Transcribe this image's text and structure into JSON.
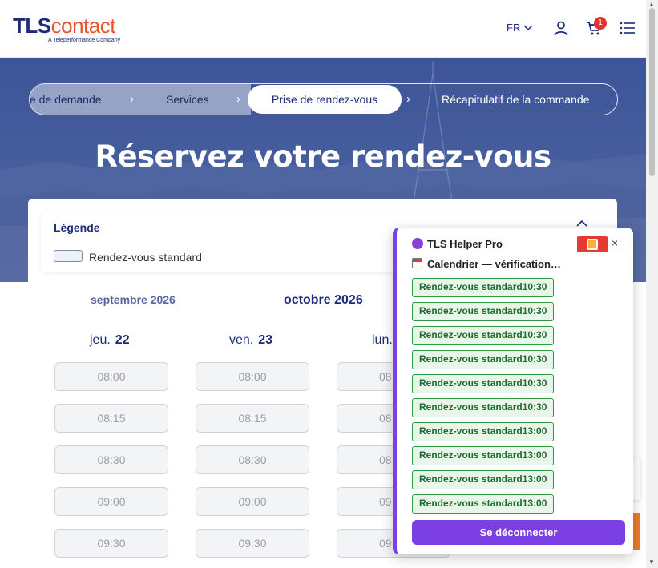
{
  "header": {
    "logo_tls": "TLS",
    "logo_contact": "contact",
    "logo_subtitle": "A Teleperformance Company",
    "lang": "FR",
    "cart_count": "1",
    "icons": [
      "chevron-down-icon",
      "user-icon",
      "cart-icon",
      "menu-icon"
    ]
  },
  "stepper": {
    "steps": [
      "e de demande",
      "Services",
      "Prise de rendez-vous",
      "Récapitulatif de la commande"
    ],
    "active_index": 2
  },
  "hero": {
    "title": "Réservez votre rendez-vous"
  },
  "legend": {
    "title": "Légende",
    "item_label": "Rendez-vous standard"
  },
  "calendar": {
    "months": [
      "septembre 2026",
      "octobre 2026"
    ],
    "days": [
      {
        "name": "jeu.",
        "num": "22"
      },
      {
        "name": "ven.",
        "num": "23"
      },
      {
        "name": "lun.",
        "num": ""
      }
    ],
    "slots": [
      "08:00",
      "08:15",
      "08:30",
      "09:00",
      "09:30"
    ],
    "slots_partial": [
      "08",
      "08",
      "08",
      "09",
      "09"
    ]
  },
  "helper": {
    "title": "TLS Helper Pro",
    "subtitle": "Calendrier — vérification…",
    "slots": [
      "Rendez-vous standard10:30",
      "Rendez-vous standard10:30",
      "Rendez-vous standard10:30",
      "Rendez-vous standard10:30",
      "Rendez-vous standard10:30",
      "Rendez-vous standard10:30",
      "Rendez-vous standard13:00",
      "Rendez-vous standard13:00",
      "Rendez-vous standard13:00",
      "Rendez-vous standard13:00"
    ],
    "close": "×",
    "logout": "Se déconnecter",
    "accent": "#7b3fe4"
  }
}
